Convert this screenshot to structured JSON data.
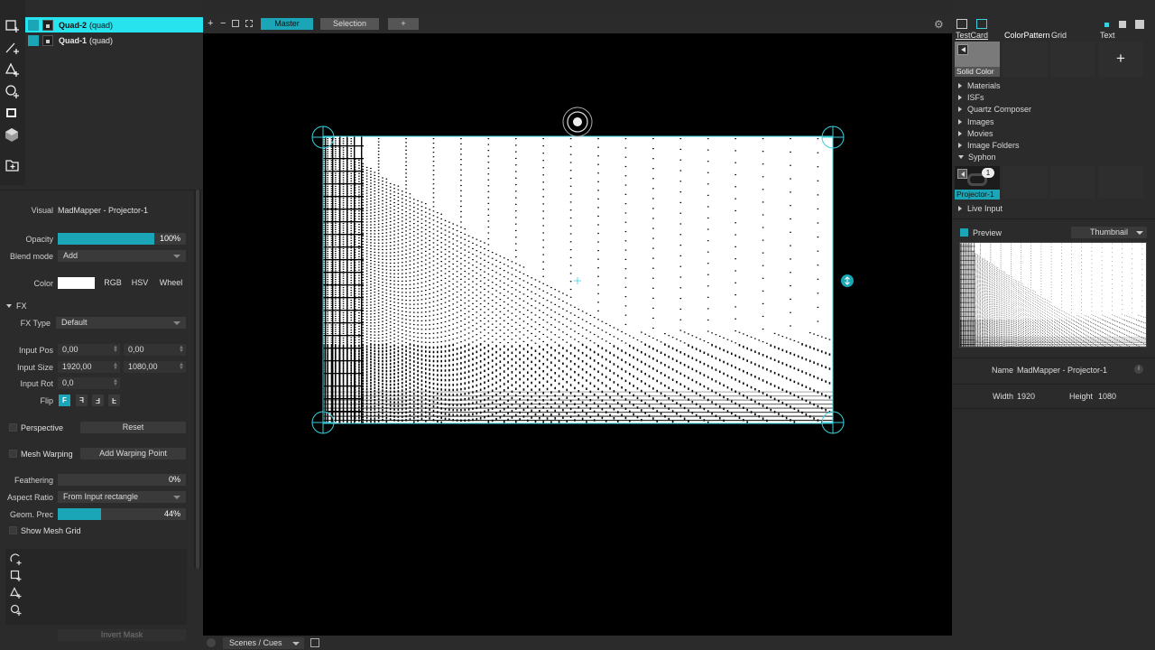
{
  "layers": [
    {
      "name": "Quad-2",
      "type": "(quad)",
      "selected": true
    },
    {
      "name": "Quad-1",
      "type": "(quad)",
      "selected": false
    }
  ],
  "tools": [
    "quad-tool-icon",
    "line-tool-icon",
    "triangle-tool-icon",
    "circle-tool-icon",
    "mask-tool-icon",
    "3d-object-icon",
    "import-icon"
  ],
  "inspector": {
    "visual_label": "Visual",
    "visual_value": "MadMapper - Projector-1",
    "opacity_label": "Opacity",
    "opacity_value": "100%",
    "opacity_fraction": 1.0,
    "blend_label": "Blend mode",
    "blend_value": "Add",
    "color_label": "Color",
    "color_swatch": "#ffffff",
    "color_modes": [
      "RGB",
      "HSV",
      "Wheel"
    ],
    "fx_section": "FX",
    "fx_type_label": "FX Type",
    "fx_type_value": "Default",
    "input_pos_label": "Input Pos",
    "input_pos_x": "0,00",
    "input_pos_y": "0,00",
    "input_size_label": "Input Size",
    "input_size_w": "1920,00",
    "input_size_h": "1080,00",
    "input_rot_label": "Input Rot",
    "input_rot_value": "0,0",
    "flip_label": "Flip",
    "flip_buttons": [
      "F",
      "F",
      "F",
      "F"
    ],
    "perspective_label": "Perspective",
    "reset_label": "Reset",
    "mesh_warping_label": "Mesh Warping",
    "add_warping_label": "Add Warping Point",
    "feathering_label": "Feathering",
    "feathering_value": "0%",
    "feathering_fraction": 0.0,
    "aspect_label": "Aspect Ratio",
    "aspect_value": "From Input rectangle",
    "geom_label": "Geom. Prec",
    "geom_value": "44%",
    "geom_fraction": 0.44,
    "show_mesh_label": "Show Mesh Grid",
    "invert_mask_label": "Invert Mask"
  },
  "toolbar": {
    "tabs": [
      "Master",
      "Selection",
      "+"
    ],
    "active_tab": "Master"
  },
  "bottom_bar": {
    "scenes_label": "Scenes / Cues"
  },
  "right": {
    "source_tabs": [
      "TestCard",
      "ColorPattern",
      "Grid",
      "Text"
    ],
    "solid_color_label": "Solid Color",
    "tree": [
      {
        "label": "Materials",
        "open": false
      },
      {
        "label": "ISFs",
        "open": false
      },
      {
        "label": "Quartz Composer",
        "open": false
      },
      {
        "label": "Images",
        "open": false
      },
      {
        "label": "Movies",
        "open": false
      },
      {
        "label": "Image Folders",
        "open": false
      },
      {
        "label": "Syphon",
        "open": true
      }
    ],
    "syphon_item": "Projector-1",
    "syphon_badge": "1",
    "live_input_label": "Live Input",
    "preview_label": "Preview",
    "preview_mode": "Thumbnail",
    "name_label": "Name",
    "name_value": "MadMapper - Projector-1",
    "width_label": "Width",
    "width_value": "1920",
    "height_label": "Height",
    "height_value": "1080"
  },
  "colors": {
    "accent": "#1aa6b7",
    "selection": "#26e3ee",
    "handle": "#3ad0dd"
  }
}
